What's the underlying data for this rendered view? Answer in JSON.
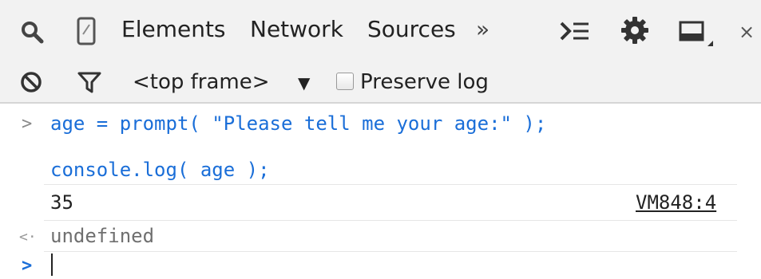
{
  "toolbar": {
    "tabs": [
      "Elements",
      "Network",
      "Sources"
    ],
    "more_tabs": "»",
    "icons": {
      "search": "search-icon",
      "device": "device-mode-icon",
      "console_drawer": "console-drawer-icon",
      "settings": "gear-icon",
      "dock": "dock-side-icon",
      "close": "×"
    }
  },
  "filterbar": {
    "frame_select": "<top frame>",
    "dropdown_arrow": "▼",
    "preserve_log_label": "Preserve log",
    "preserve_log_checked": false
  },
  "console": {
    "input_prompt": ">",
    "result_prompt": "<·",
    "command_line_1": "age = prompt( \"Please tell me your age:\" );",
    "command_line_2": "console.log( age );",
    "log_output": "35",
    "log_source": "VM848:4",
    "result_value": "undefined"
  },
  "colors": {
    "code_blue": "#1a6ed8",
    "prompt_blue": "#1a6ed8",
    "muted_gray": "#8a8a8a"
  }
}
